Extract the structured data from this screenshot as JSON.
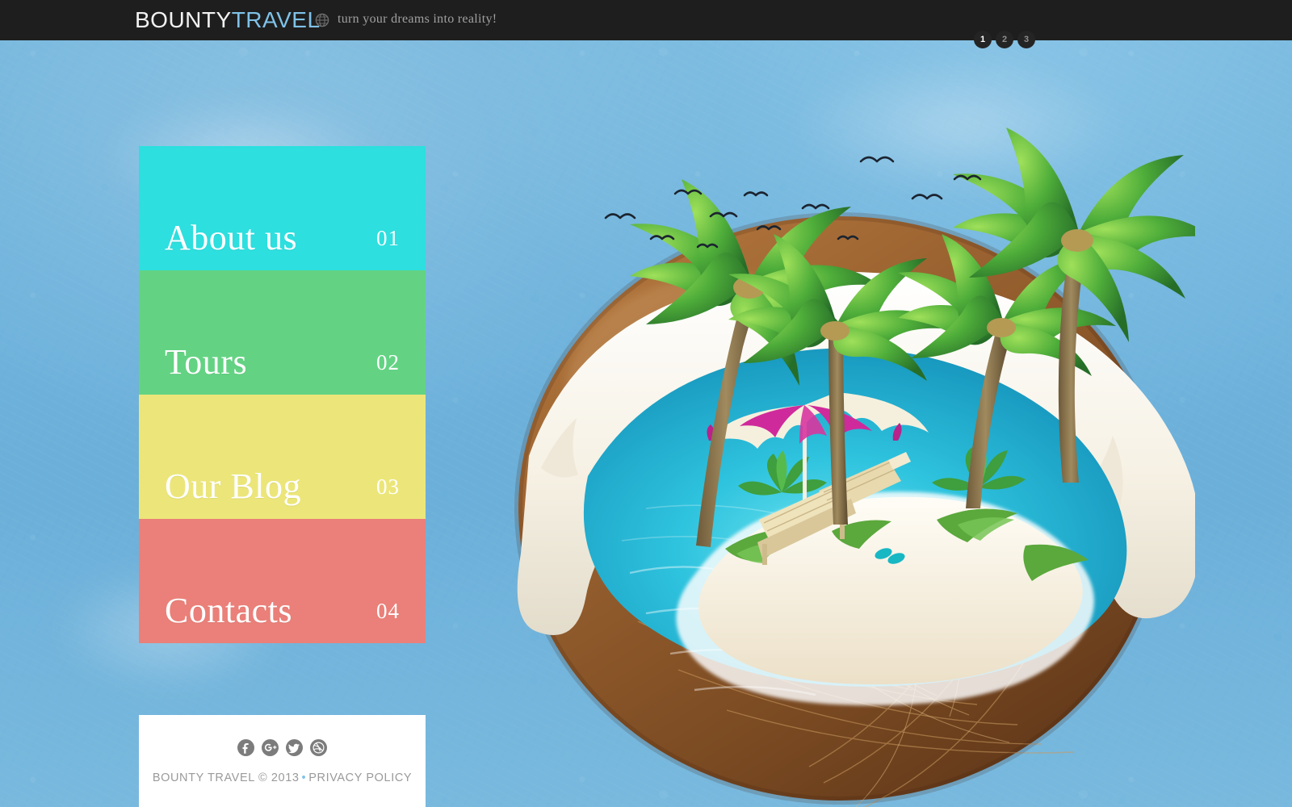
{
  "header": {
    "brand_primary": "BOUNTY",
    "brand_secondary": "TRAVEL",
    "globe_icon": "globe-icon",
    "tagline": "turn your dreams into reality!"
  },
  "slider": {
    "pagination": [
      {
        "label": "1",
        "active": true
      },
      {
        "label": "2",
        "active": false
      },
      {
        "label": "3",
        "active": false
      }
    ]
  },
  "menu": {
    "items": [
      {
        "label": "About us",
        "number": "01",
        "color": "#2ddfdf"
      },
      {
        "label": "Tours",
        "number": "02",
        "color": "#63d383"
      },
      {
        "label": "Our Blog",
        "number": "03",
        "color": "#ece67a"
      },
      {
        "label": "Contacts",
        "number": "04",
        "color": "#ea8079"
      }
    ]
  },
  "footer": {
    "socials": [
      {
        "name": "facebook-icon",
        "label": "f"
      },
      {
        "name": "google-plus-icon",
        "label": "g+"
      },
      {
        "name": "twitter-icon",
        "label": "t"
      },
      {
        "name": "dribbble-icon",
        "label": "d"
      }
    ],
    "copyright_text": "BOUNTY TRAVEL © 2013",
    "separator": "•",
    "privacy_policy": "PRIVACY POLICY"
  },
  "artwork": {
    "description": "tropical island inside a halved coconut",
    "sky_color": "#6fb3dc",
    "lagoon_color": "#27c0d8",
    "sand_color": "#f4ead8",
    "husk_color": "#8b5a2b",
    "flesh_color": "#f7f3e8",
    "umbrella_colors": [
      "#cf2a9b",
      "#f5f0dd"
    ]
  }
}
